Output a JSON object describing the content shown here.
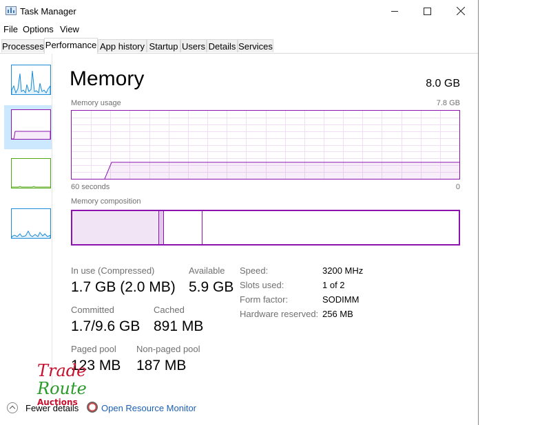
{
  "window": {
    "title": "Task Manager"
  },
  "menu": [
    "File",
    "Options",
    "View"
  ],
  "tabs": [
    "Processes",
    "Performance",
    "App history",
    "Startup",
    "Users",
    "Details",
    "Services"
  ],
  "active_tab": "Performance",
  "memory": {
    "title": "Memory",
    "total": "8.0 GB",
    "usage_label": "Memory usage",
    "usage_max": "7.8 GB",
    "time_left": "60 seconds",
    "time_right": "0",
    "usage_fraction": 0.24,
    "composition_label": "Memory composition",
    "composition": {
      "in_use_fraction": 0.225,
      "modified_fraction": 0.012,
      "standby_fraction": 0.1,
      "free_fraction": 0.663
    }
  },
  "stats": {
    "in_use_label": "In use (Compressed)",
    "in_use_value": "1.7 GB (2.0 MB)",
    "available_label": "Available",
    "available_value": "5.9 GB",
    "committed_label": "Committed",
    "committed_value": "1.7/9.6 GB",
    "cached_label": "Cached",
    "cached_value": "891 MB",
    "paged_label": "Paged pool",
    "paged_value": "123 MB",
    "nonpaged_label": "Non-paged pool",
    "nonpaged_value": "187 MB"
  },
  "specs": {
    "speed_label": "Speed:",
    "speed_value": "3200 MHz",
    "slots_label": "Slots used:",
    "slots_value": "1 of 2",
    "form_label": "Form factor:",
    "form_value": "SODIMM",
    "hw_label": "Hardware reserved:",
    "hw_value": "256 MB"
  },
  "footer": {
    "fewer_details": "Fewer details",
    "resource_monitor": "Open Resource Monitor"
  },
  "watermark": {
    "line1": "Trade",
    "line2": "Route",
    "line3": "Auctions"
  },
  "colors": {
    "memory_accent": "#8b12ae",
    "cpu": "#1a8bd4",
    "disk": "#4da60c",
    "network": "#a85e00"
  }
}
